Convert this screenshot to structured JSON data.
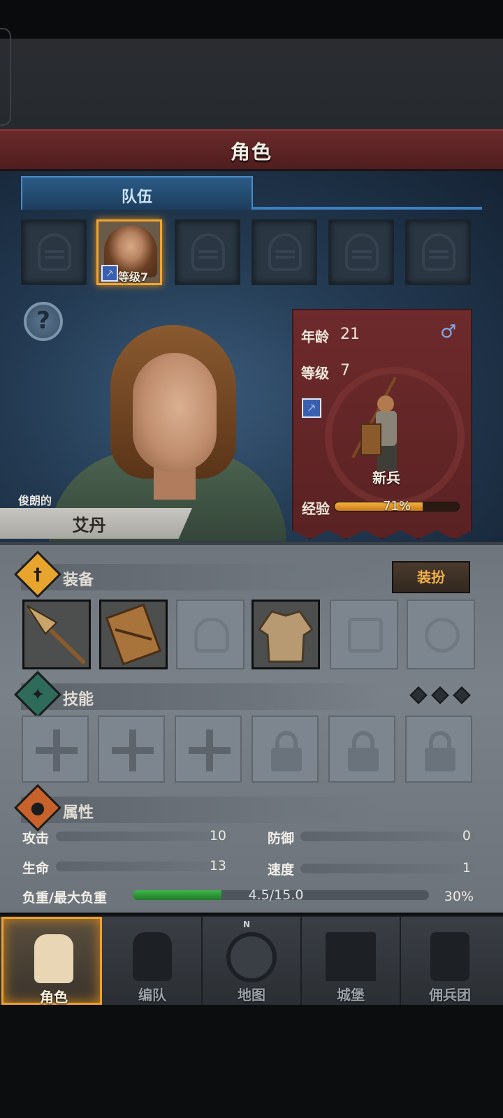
{
  "header": {
    "title": "角色"
  },
  "party": {
    "tab_label": "队伍",
    "selected_level": "等级7"
  },
  "character": {
    "adjective": "俊朗的",
    "name": "艾丹",
    "age_label": "年龄",
    "age": "21",
    "level_label": "等级",
    "level": "7",
    "gender_icon": "male-symbol",
    "class_name": "新兵",
    "xp_label": "经验",
    "xp_text": "71%",
    "xp_progress": 0.71
  },
  "equipment": {
    "title": "装备",
    "dress_button": "装扮",
    "slots": [
      "spear",
      "wooden-shield",
      "helmet-empty",
      "cloth-tunic",
      "boots-empty",
      "ring-empty"
    ]
  },
  "skills": {
    "title": "技能",
    "slots": [
      "skill-cross",
      "skill-cross",
      "skill-cross",
      "locked",
      "locked",
      "locked"
    ],
    "points_icons": 3
  },
  "attributes": {
    "title": "属性",
    "attack_label": "攻击",
    "attack": "10",
    "defense_label": "防御",
    "defense": "0",
    "health_label": "生命",
    "health": "13",
    "speed_label": "速度",
    "speed": "1",
    "weight_label": "负重/最大负重",
    "weight_text": "4.5/15.0",
    "weight_percent": "30%",
    "weight_progress": 0.3
  },
  "nav": {
    "items": [
      "角色",
      "编队",
      "地图",
      "城堡",
      "佣兵团"
    ],
    "compass_label": "N",
    "active": "角色"
  },
  "colors": {
    "accent_orange": "#f0a12c",
    "header_red": "#6a2a2a",
    "xp_fill": "#f5b23e",
    "weight_fill": "#3fb64a",
    "tab_blue": "#2b5b86"
  }
}
